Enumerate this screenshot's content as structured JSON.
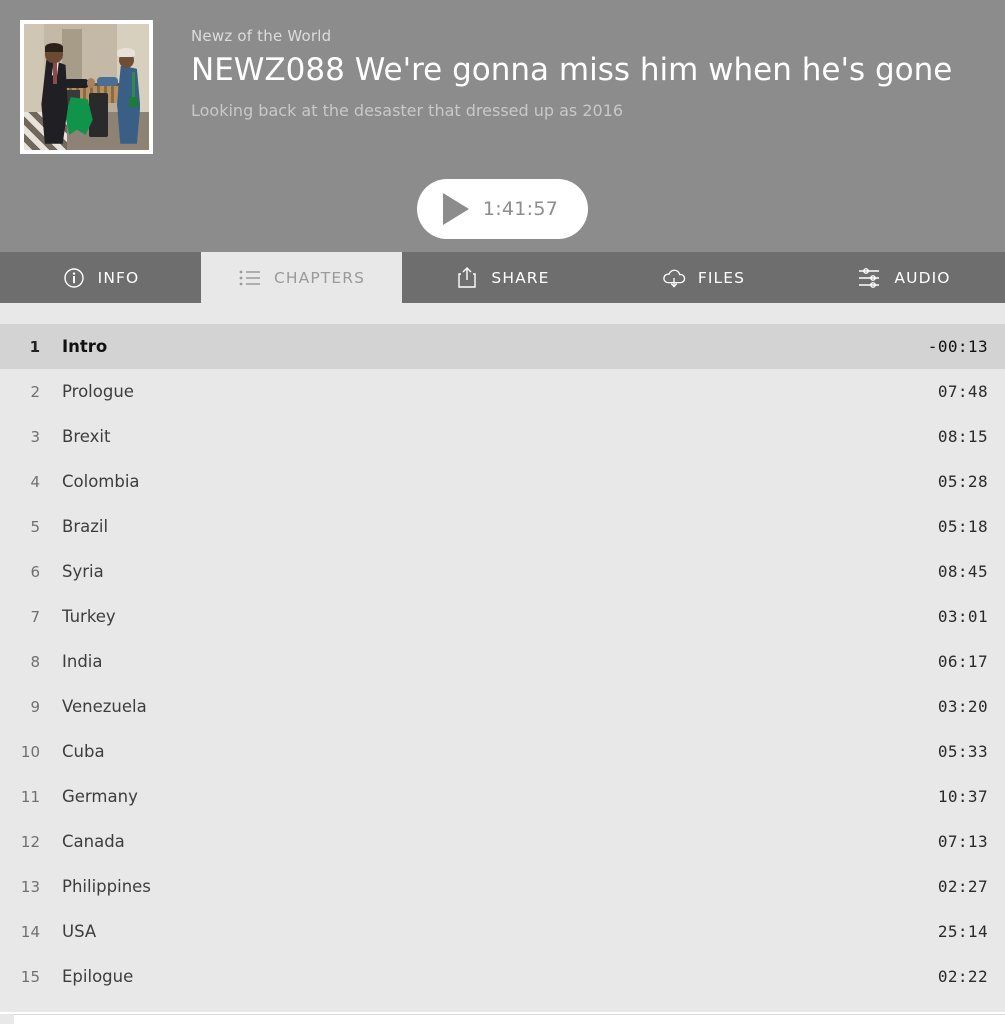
{
  "header": {
    "show_name": "Newz of the World",
    "episode_title": "NEWZ088 We're gonna miss him when he's gone",
    "episode_subtitle": "Looking back at the desaster that dressed up as 2016",
    "artwork_alt": "Obama fist-bumping a worker in a corridor",
    "background_color": "#8c8c8c",
    "play_button": {
      "icon": "play-icon",
      "duration": "1:41:57",
      "background_color": "#ffffff",
      "foreground_color": "#8c8c8c"
    }
  },
  "tabs": [
    {
      "label": "INFO",
      "icon": "info-circle-icon",
      "active": false
    },
    {
      "label": "CHAPTERS",
      "icon": "list-icon",
      "active": true
    },
    {
      "label": "SHARE",
      "icon": "share-upload-icon",
      "active": false
    },
    {
      "label": "FILES",
      "icon": "cloud-download-icon",
      "active": false
    },
    {
      "label": "AUDIO",
      "icon": "sliders-icon",
      "active": false
    }
  ],
  "chapters": {
    "current_index": 0,
    "rows": [
      {
        "num": "1",
        "title": "Intro",
        "time": "-00:13"
      },
      {
        "num": "2",
        "title": "Prologue",
        "time": "07:48"
      },
      {
        "num": "3",
        "title": "Brexit",
        "time": "08:15"
      },
      {
        "num": "4",
        "title": "Colombia",
        "time": "05:28"
      },
      {
        "num": "5",
        "title": "Brazil",
        "time": "05:18"
      },
      {
        "num": "6",
        "title": "Syria",
        "time": "08:45"
      },
      {
        "num": "7",
        "title": "Turkey",
        "time": "03:01"
      },
      {
        "num": "8",
        "title": "India",
        "time": "06:17"
      },
      {
        "num": "9",
        "title": "Venezuela",
        "time": "03:20"
      },
      {
        "num": "10",
        "title": "Cuba",
        "time": "05:33"
      },
      {
        "num": "11",
        "title": "Germany",
        "time": "10:37"
      },
      {
        "num": "12",
        "title": "Canada",
        "time": "07:13"
      },
      {
        "num": "13",
        "title": "Philippines",
        "time": "02:27"
      },
      {
        "num": "14",
        "title": "USA",
        "time": "25:14"
      },
      {
        "num": "15",
        "title": "Epilogue",
        "time": "02:22"
      }
    ]
  },
  "colors": {
    "header_bg": "#8c8c8c",
    "tab_bg": "#6e6e6e",
    "tab_active_bg": "#e8e8e8",
    "list_bg": "#e8e8e8",
    "row_current_bg": "#d3d3d3"
  }
}
